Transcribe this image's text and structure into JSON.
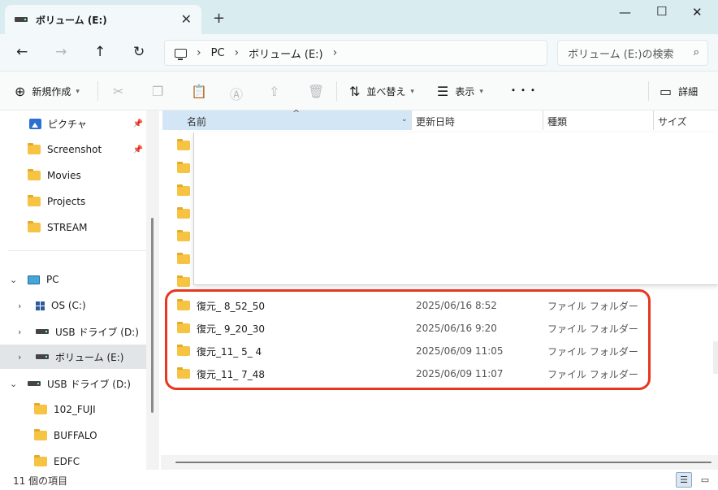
{
  "window": {
    "tab_title": "ボリューム (E:)",
    "new_tab_icon": "plus-icon",
    "controls": [
      "minimize-icon",
      "maximize-icon",
      "close-icon"
    ]
  },
  "nav": {
    "breadcrumb": [
      "PC",
      "ボリューム (E:)"
    ],
    "search_placeholder": "ボリューム (E:)の検索"
  },
  "commands": {
    "new_label": "新規作成",
    "sort_label": "並べ替え",
    "view_label": "表示",
    "more_label": "・・・",
    "details_label": "詳細"
  },
  "sidebar": {
    "quick": [
      {
        "label": "ピクチャ",
        "icon": "pictures-icon",
        "pinned": true
      },
      {
        "label": "Screenshot",
        "icon": "folder-icon",
        "pinned": true
      },
      {
        "label": "Movies",
        "icon": "folder-icon",
        "pinned": false
      },
      {
        "label": "Projects",
        "icon": "folder-icon",
        "pinned": false
      },
      {
        "label": "STREAM",
        "icon": "folder-icon",
        "pinned": false
      }
    ],
    "pc": {
      "label": "PC"
    },
    "drives": [
      {
        "label": "OS (C:)"
      },
      {
        "label": "USB ドライブ (D:)"
      },
      {
        "label": "ボリューム (E:)"
      }
    ],
    "usb_expanded": {
      "label": "USB ドライブ (D:)"
    },
    "usb_children": [
      {
        "label": "102_FUJI"
      },
      {
        "label": "BUFFALO"
      },
      {
        "label": "EDFC"
      }
    ]
  },
  "columns": {
    "name": "名前",
    "date": "更新日時",
    "type": "種類",
    "size": "サイズ"
  },
  "files": [
    {
      "name": "復元_ 8_52_50",
      "date": "2025/06/16 8:52",
      "type": "ファイル フォルダー"
    },
    {
      "name": "復元_ 9_20_30",
      "date": "2025/06/16 9:20",
      "type": "ファイル フォルダー"
    },
    {
      "name": "復元_11_ 5_ 4",
      "date": "2025/06/09 11:05",
      "type": "ファイル フォルダー"
    },
    {
      "name": "復元_11_ 7_48",
      "date": "2025/06/09 11:07",
      "type": "ファイル フォルダー"
    }
  ],
  "status": {
    "item_count": "11 個の項目"
  },
  "colors": {
    "highlight": "#e8361f",
    "titlebar": "#d9ecf0",
    "folder": "#f6c343"
  }
}
